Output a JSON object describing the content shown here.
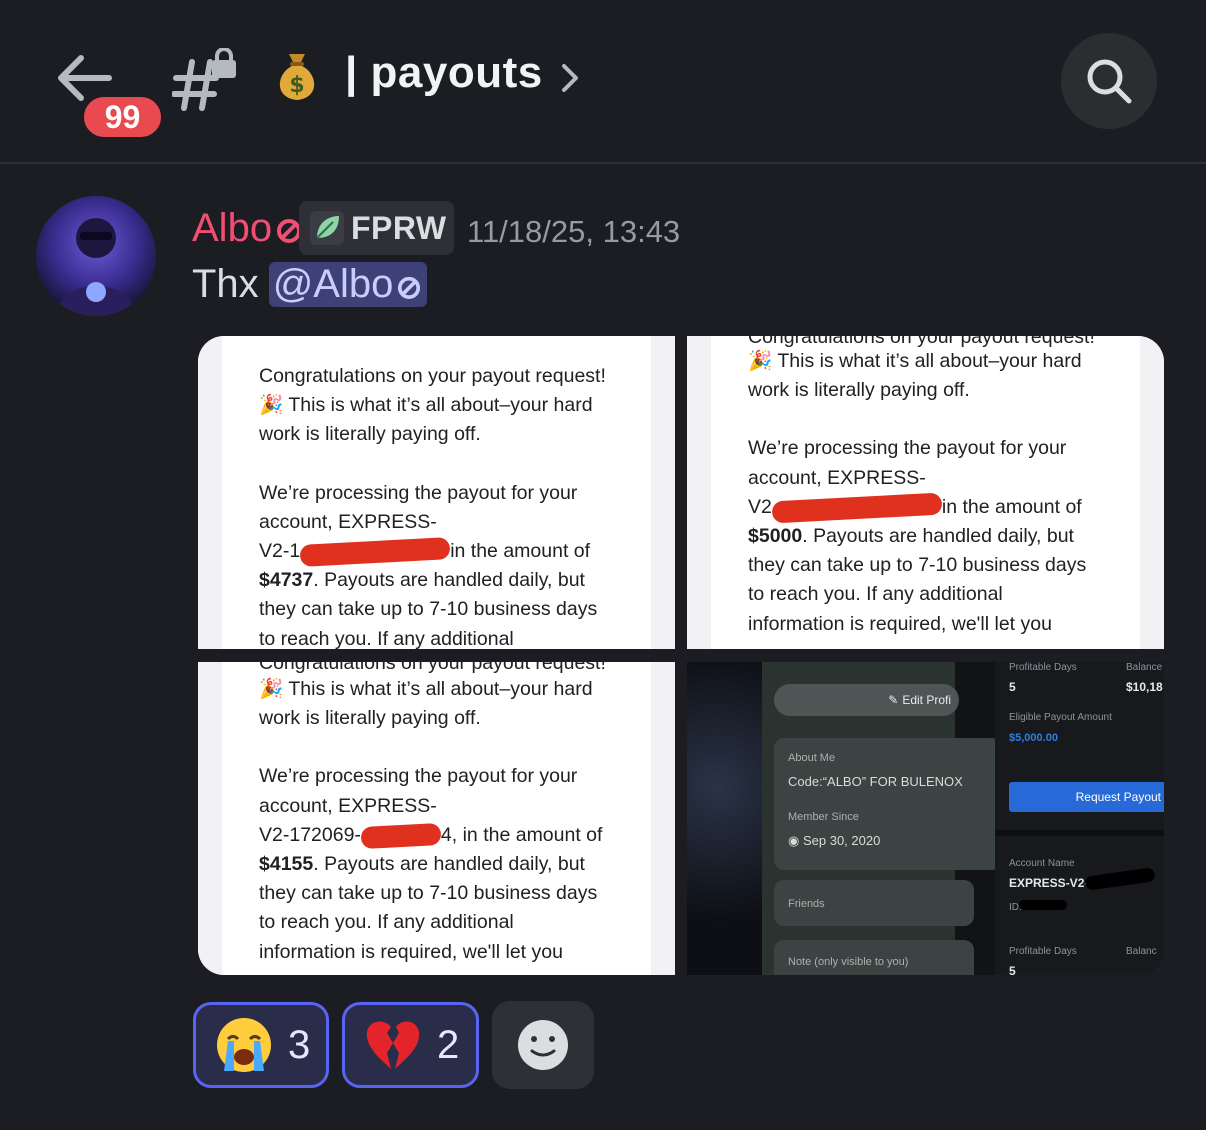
{
  "header": {
    "unread_badge": "99",
    "channel_name": "| payouts",
    "channel_emoji": "money-bag",
    "icons": [
      "back-arrow-icon",
      "locked-hash-icon",
      "chevron-right-icon",
      "search-icon"
    ]
  },
  "message": {
    "author": "Albo",
    "author_color": "#f04f72",
    "guild_tag": "FPRW",
    "timestamp": "11/18/25, 13:43",
    "text": "Thx",
    "mention": "@Albo"
  },
  "attachments": {
    "a1": {
      "line1": "Congratulations on your payout request!",
      "line2": "This is what it’s all about–your hard",
      "line3": "work is literally paying off.",
      "line4": "We’re processing the payout for your",
      "line5": "account, EXPRESS-",
      "line6a": "V2-1",
      "line6b": "in the amount of",
      "amount": "$4737",
      "line7": ". Payouts are handled daily, but",
      "line8": "they can take up to 7-10 business days",
      "line9": "to reach you. If any additional"
    },
    "a2": {
      "cut": "Congratulations on your payout request!",
      "line2": "This is what it’s all about–your hard",
      "line3": "work is literally paying off.",
      "line4": "We’re processing the payout for your",
      "line5": "account, EXPRESS-",
      "line6a": "V2",
      "line6b": "in the amount of",
      "amount": "$5000",
      "line7": ". Payouts are handled daily, but",
      "line8": "they can take up to 7-10 business days",
      "line9": "to reach you. If any additional",
      "line10": "information is required, we'll let you"
    },
    "a3": {
      "cut": "Congratulations on your payout request!",
      "line2": "This is what it’s all about–your hard",
      "line3": "work is literally paying off.",
      "line4": "We’re processing the payout for your",
      "line5": "account, EXPRESS-",
      "line6a": "V2-172069-",
      "line6b": "4, in the amount of",
      "amount": "$4155",
      "line7": ". Payouts are handled daily, but",
      "line8": "they can take up to 7-10 business days",
      "line9": "to reach you. If any additional",
      "line10": "information is required, we'll let you"
    },
    "a4": {
      "edit_profile": "Edit Profi",
      "about_me_label": "About Me",
      "about_me_value": "Code:“ALBO” FOR BULENOX",
      "member_since_label": "Member Since",
      "member_since_value": "Sep 30, 2020",
      "friends": "Friends",
      "note": "Note (only visible to you)",
      "profitable_days_label": "Profitable Days",
      "profitable_days_value": "5",
      "balance_label": "Balance",
      "balance_value": "$10,18",
      "eligible_label": "Eligible Payout Amount",
      "eligible_value": "$5,000.00",
      "request_button": "Request Payout",
      "account_name_label": "Account Name",
      "account_name_value": "EXPRESS-V2-",
      "id_label": "ID:",
      "profitable_days_label_2": "Profitable Days",
      "profitable_days_value_2": "5",
      "balance_label_2": "Balanc"
    }
  },
  "reactions": [
    {
      "emoji": "loudly-crying-face",
      "count": "3"
    },
    {
      "emoji": "broken-heart",
      "count": "2"
    }
  ],
  "colors": {
    "background": "#1c1d22",
    "badge": "#e84a4f",
    "mention_bg": "#3d4177",
    "reaction_border": "#5865f2",
    "redaction": "#e0311f",
    "payout_blue": "#2f7fe0"
  }
}
